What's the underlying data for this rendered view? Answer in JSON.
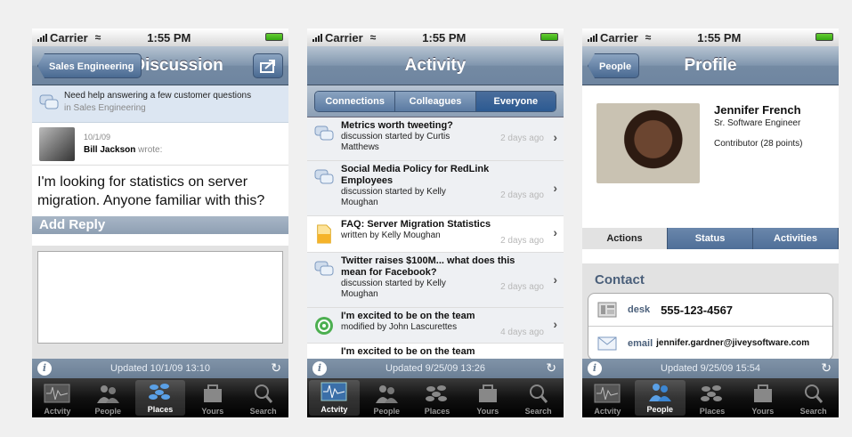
{
  "status": {
    "carrier": "Carrier",
    "time": "1:55 PM"
  },
  "tabs": [
    "Actvity",
    "People",
    "Places",
    "Yours",
    "Search"
  ],
  "discussion": {
    "back": "Sales Engineering",
    "title": "Discussion",
    "context_text": "Need help answering a few customer questions",
    "context_place": "in Sales Engineering",
    "date": "10/1/09",
    "author": "Bill Jackson",
    "wrote": "wrote:",
    "message": "I'm looking for statistics on server migration. Anyone familiar with this?",
    "reply_header": "Add Reply",
    "updated": "Updated 10/1/09 13:10"
  },
  "activity": {
    "title": "Activity",
    "segments": [
      "Connections",
      "Colleagues",
      "Everyone"
    ],
    "items": [
      {
        "title": "Metrics worth tweeting?",
        "sub": "discussion started by Curtis Matthews",
        "ago": "2 days ago"
      },
      {
        "title": "Social Media Policy for RedLink Employees",
        "sub": "discussion started by Kelly Moughan",
        "ago": "2 days ago"
      },
      {
        "title": "FAQ: Server Migration Statistics",
        "sub": "written by Kelly Moughan",
        "ago": "2 days ago"
      },
      {
        "title": "Twitter raises $100M... what does this mean for Facebook?",
        "sub": "discussion started by Kelly Moughan",
        "ago": "2 days ago"
      },
      {
        "title": "I'm excited to be on the team",
        "sub": "modified by John Lascurettes",
        "ago": "4 days ago"
      },
      {
        "title": "I'm excited to be on the team",
        "sub": "",
        "ago": ""
      }
    ],
    "updated": "Updated 9/25/09 13:26"
  },
  "profile": {
    "back": "People",
    "title": "Profile",
    "name": "Jennifer French",
    "role": "Sr. Software Engineer",
    "contrib": "Contributor (28 points)",
    "tabs": [
      "Actions",
      "Status",
      "Activities"
    ],
    "contact_header": "Contact",
    "desk_label": "desk",
    "desk": "555-123-4567",
    "email_label": "email",
    "email": "jennifer.gardner@jiveysoftware.com",
    "updated": "Updated 9/25/09 15:54"
  }
}
